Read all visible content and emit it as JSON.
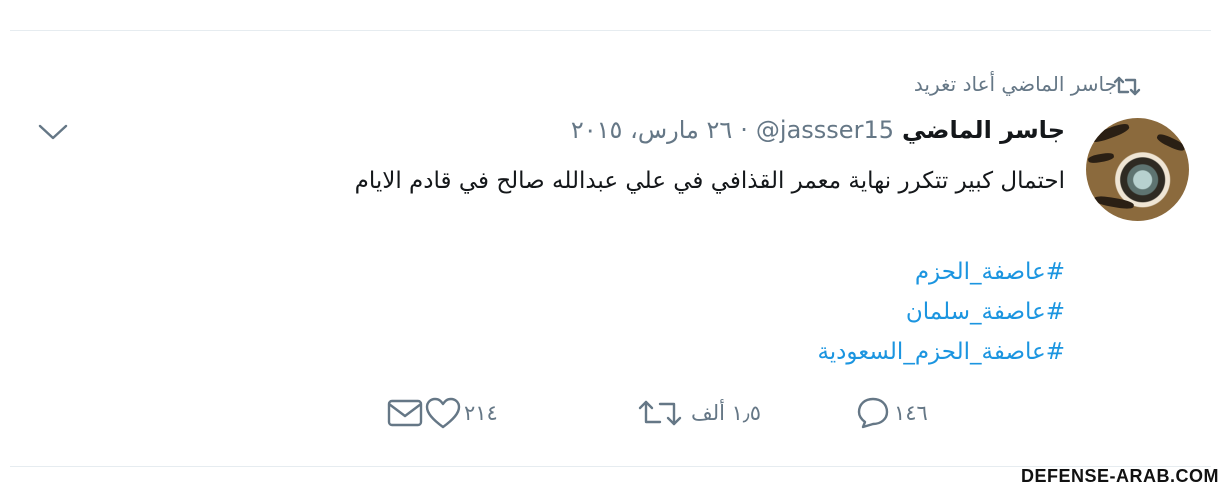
{
  "retweet_context": "جاسر الماضي أعاد تغريد",
  "tweet": {
    "display_name": "جاسر الماضي",
    "handle": "@jassser15",
    "separator": "·",
    "date": "٢٦ مارس، ٢٠١٥",
    "text": "احتمال كبير تتكرر نهاية معمر القذافي في علي عبدالله صالح في قادم الايام",
    "hashtags": [
      "#عاصفة_الحزم",
      "#عاصفة_سلمان",
      "#عاصفة_الحزم_السعودية"
    ]
  },
  "actions": {
    "reply_count": "١٤٦",
    "retweet_count": "١٫٥ ألف",
    "like_count": "٢١٤"
  },
  "watermark": "DEFENSE-ARAB.COM",
  "icons": {
    "retweet_context": "retweet-icon",
    "menu": "chevron-down-icon",
    "reply": "reply-icon",
    "retweet": "retweet-icon",
    "like": "heart-icon",
    "dm": "envelope-icon"
  },
  "colors": {
    "link": "#1b95e0",
    "secondary_text": "#657786",
    "divider": "#e6ecf0"
  }
}
